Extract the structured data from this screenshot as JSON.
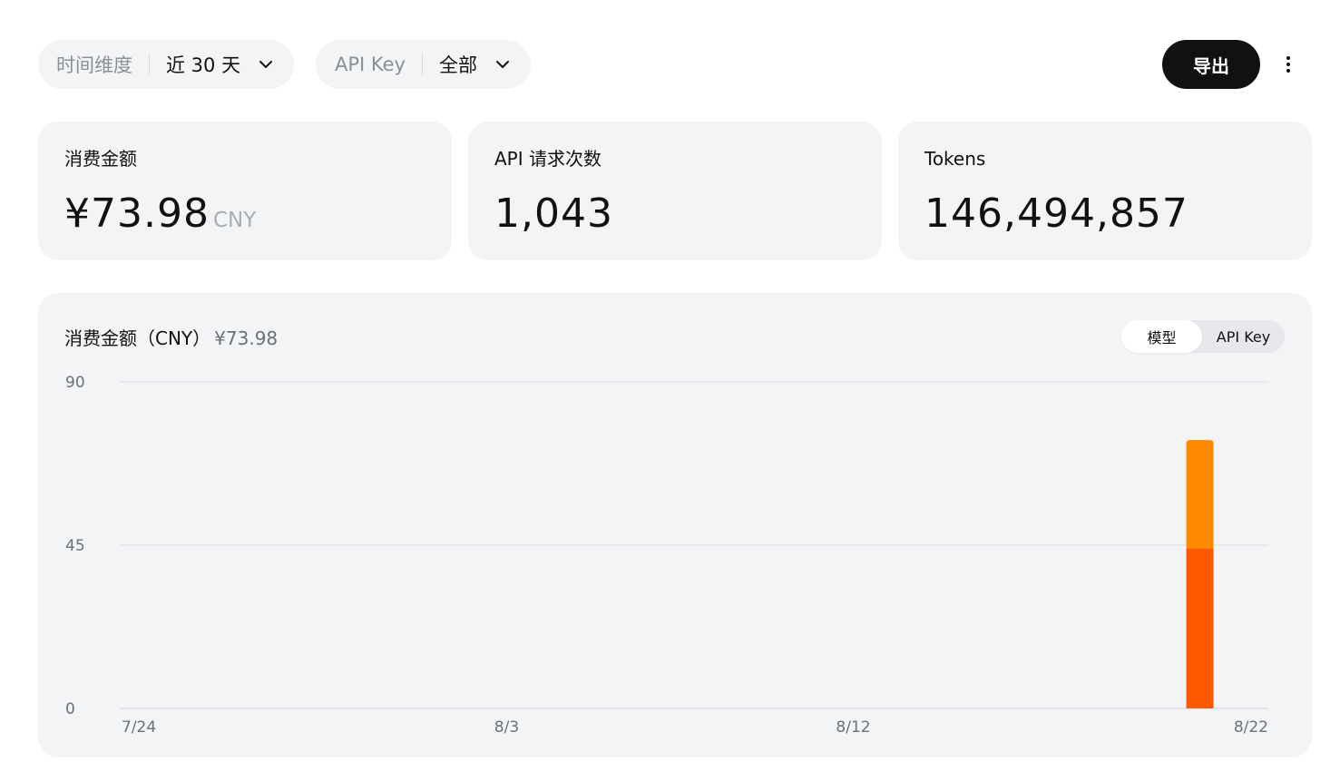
{
  "filters": {
    "range": {
      "label": "时间维度",
      "value": "近 30 天"
    },
    "api_key": {
      "label": "API Key",
      "value": "全部"
    }
  },
  "actions": {
    "export_label": "导出",
    "more_icon": "more-vertical-icon",
    "chevron_icon": "chevron-down-icon"
  },
  "cards": {
    "cost": {
      "label": "消费金额",
      "value": "¥73.98",
      "unit": "CNY"
    },
    "requests": {
      "label": "API 请求次数",
      "value": "1,043"
    },
    "tokens": {
      "label": "Tokens",
      "value": "146,494,857"
    }
  },
  "chart_panel": {
    "title": "消费金额（CNY）",
    "total": "¥73.98",
    "toggle": {
      "active": "模型",
      "inactive": "API Key"
    }
  },
  "chart_data": {
    "type": "bar",
    "stacked": true,
    "title": "消费金额（CNY）",
    "xlabel": "",
    "ylabel": "",
    "ylim": [
      0,
      90
    ],
    "yticks": [
      0,
      45,
      90
    ],
    "x_tick_labels": [
      "7/24",
      "8/3",
      "8/12",
      "8/22"
    ],
    "categories": [
      "7/24",
      "7/25",
      "7/26",
      "7/27",
      "7/28",
      "7/29",
      "7/30",
      "7/31",
      "8/1",
      "8/2",
      "8/3",
      "8/4",
      "8/5",
      "8/6",
      "8/7",
      "8/8",
      "8/9",
      "8/10",
      "8/11",
      "8/12",
      "8/13",
      "8/14",
      "8/15",
      "8/16",
      "8/17",
      "8/18",
      "8/19",
      "8/20",
      "8/21",
      "8/22"
    ],
    "series": [
      {
        "color": "#ff5a00",
        "values": [
          0,
          0,
          0,
          0,
          0,
          0,
          0,
          0,
          0,
          0,
          0,
          0,
          0,
          0,
          0,
          0,
          0,
          0,
          0,
          0,
          0,
          0,
          0,
          0,
          0,
          0,
          0,
          0,
          44,
          0
        ]
      },
      {
        "color": "#ff8a00",
        "values": [
          0,
          0,
          0,
          0,
          0,
          0,
          0,
          0,
          0,
          0,
          0,
          0,
          0,
          0,
          0,
          0,
          0,
          0,
          0,
          0,
          0,
          0,
          0,
          0,
          0,
          0,
          0,
          0,
          29.98,
          0
        ]
      }
    ],
    "grid": true,
    "legend": "none"
  }
}
